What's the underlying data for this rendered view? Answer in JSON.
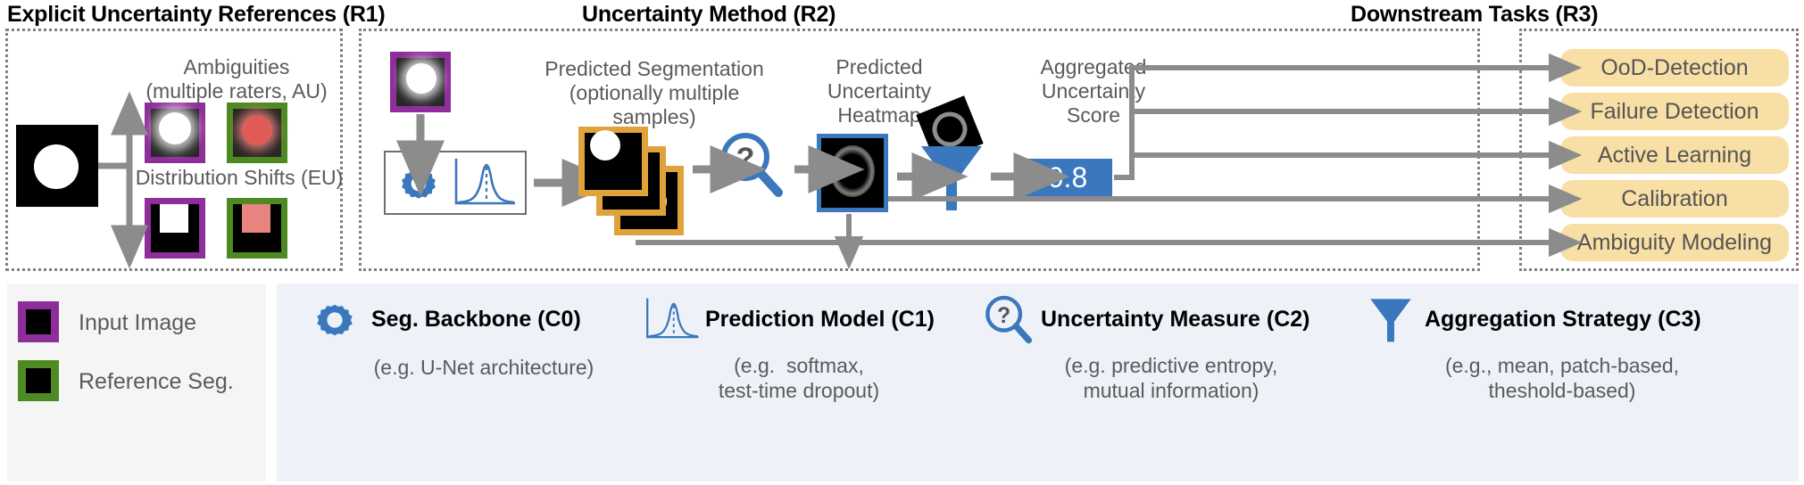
{
  "regions": [
    {
      "id": "R1",
      "title": "Explicit Uncertainty References (R1)"
    },
    {
      "id": "R2",
      "title": "Uncertainty Method (R2)"
    },
    {
      "id": "R3",
      "title": "Downstream Tasks (R3)"
    }
  ],
  "r1": {
    "ambiguities_label": "Ambiguities\n(multiple raters, AU)",
    "distribution_label": "Distribution Shifts (EU)"
  },
  "r2": {
    "predicted_segmentation_label": "Predicted Segmentation\n(optionally multiple\nsamples)",
    "predicted_heatmap_label": "Predicted\nUncertainty\nHeatmap",
    "aggregated_score_label": "Aggregated\nUncertainty\nScore",
    "score_value": "0.8"
  },
  "r3": {
    "tasks": [
      {
        "label": "OoD-Detection"
      },
      {
        "label": "Failure Detection"
      },
      {
        "label": "Active Learning"
      },
      {
        "label": "Calibration"
      },
      {
        "label": "Ambiguity Modeling"
      }
    ]
  },
  "legend": {
    "swatches": [
      {
        "icon": "purple-bordered-image-icon",
        "label": "Input Image",
        "color": "#8d2e9a"
      },
      {
        "icon": "green-bordered-image-icon",
        "label": "Reference Seg.",
        "color": "#4e8a22"
      }
    ],
    "components": [
      {
        "icon": "gear-icon",
        "title": "Seg. Backbone (C0)",
        "subtitle": "(e.g. U-Net architecture)"
      },
      {
        "icon": "distribution-curve-icon",
        "title": "Prediction Model (C1)",
        "subtitle": "(e.g.  softmax,\ntest-time dropout)"
      },
      {
        "icon": "magnifier-question-icon",
        "title": "Uncertainty Measure (C2)",
        "subtitle": "(e.g. predictive entropy,\nmutual information)"
      },
      {
        "icon": "funnel-icon",
        "title": "Aggregation Strategy (C3)",
        "subtitle": "(e.g., mean, patch-based,\ntheshold-based)"
      }
    ]
  },
  "colors": {
    "purple": "#8d2e9a",
    "green": "#4e8a22",
    "blue": "#3a77bd",
    "orange": "#e0a33c",
    "pill": "#f7dfa5",
    "arrow": "#8c8c8c",
    "text_gray": "#5a5a5a",
    "salmon": "#e8847e",
    "legend_left_bg": "#f5f5f5",
    "legend_right_bg": "#eef2f8"
  }
}
